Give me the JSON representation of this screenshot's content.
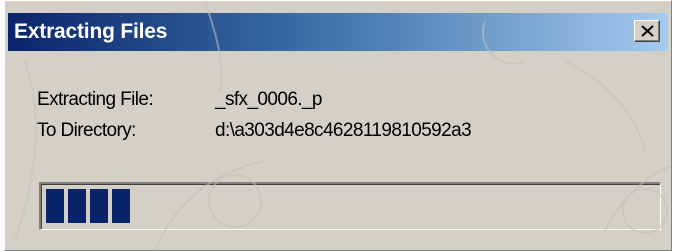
{
  "window": {
    "title": "Extracting Files"
  },
  "fields": {
    "file_label": "Extracting File:",
    "file_value": "_sfx_0006._p",
    "dir_label": "To Directory:",
    "dir_value": "d:\\a303d4e8c4628119810592a3"
  },
  "progress": {
    "block_count": 4,
    "block_color": "#0a246a"
  },
  "icons": {
    "close": "close-icon"
  },
  "colors": {
    "title_start": "#0a246a",
    "title_end": "#a6caf0",
    "face": "#d4d0c8"
  }
}
